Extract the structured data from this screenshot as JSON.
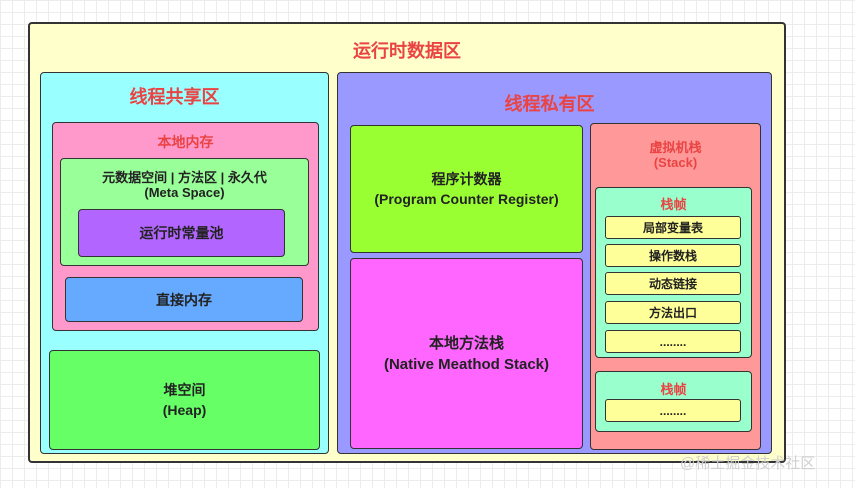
{
  "title": "运行时数据区",
  "shared": {
    "title": "线程共享区",
    "native_memory": {
      "title": "本地内存",
      "metaspace": {
        "line1": "元数据空间 | 方法区 | 永久代",
        "line2": "(Meta Space)"
      },
      "constant_pool": "运行时常量池",
      "direct_memory": "直接内存"
    },
    "heap": {
      "line1": "堆空间",
      "line2": "(Heap)"
    }
  },
  "private": {
    "title": "线程私有区",
    "pc_register": {
      "line1": "程序计数器",
      "line2": "(Program Counter Register)"
    },
    "native_method_stack": {
      "line1": "本地方法栈",
      "line2": "(Native Meathod Stack)"
    },
    "vm_stack": {
      "line1": "虚拟机栈",
      "line2": "(Stack)",
      "frames": [
        {
          "title": "栈帧",
          "items": [
            "局部变量表",
            "操作数栈",
            "动态链接",
            "方法出口",
            "........"
          ]
        },
        {
          "title": "栈帧",
          "items": [
            "........"
          ]
        }
      ]
    }
  },
  "watermark": "@稀土掘金技术社区",
  "colors": {
    "outer_bg": "#ffffcc",
    "shared_bg": "#99ffff",
    "private_bg": "#9999ff",
    "native_memory_bg": "#ff99cc",
    "metaspace_bg": "#99ff99",
    "constant_pool_bg": "#b266ff",
    "direct_memory_bg": "#66aaff",
    "heap_bg": "#66ff66",
    "pc_register_bg": "#99ff33",
    "native_method_stack_bg": "#ff66ff",
    "vm_stack_bg": "#ff9999",
    "frame_bg": "#99ffcc",
    "frame_item_bg": "#ffff99",
    "title_red": "#ea4343"
  }
}
